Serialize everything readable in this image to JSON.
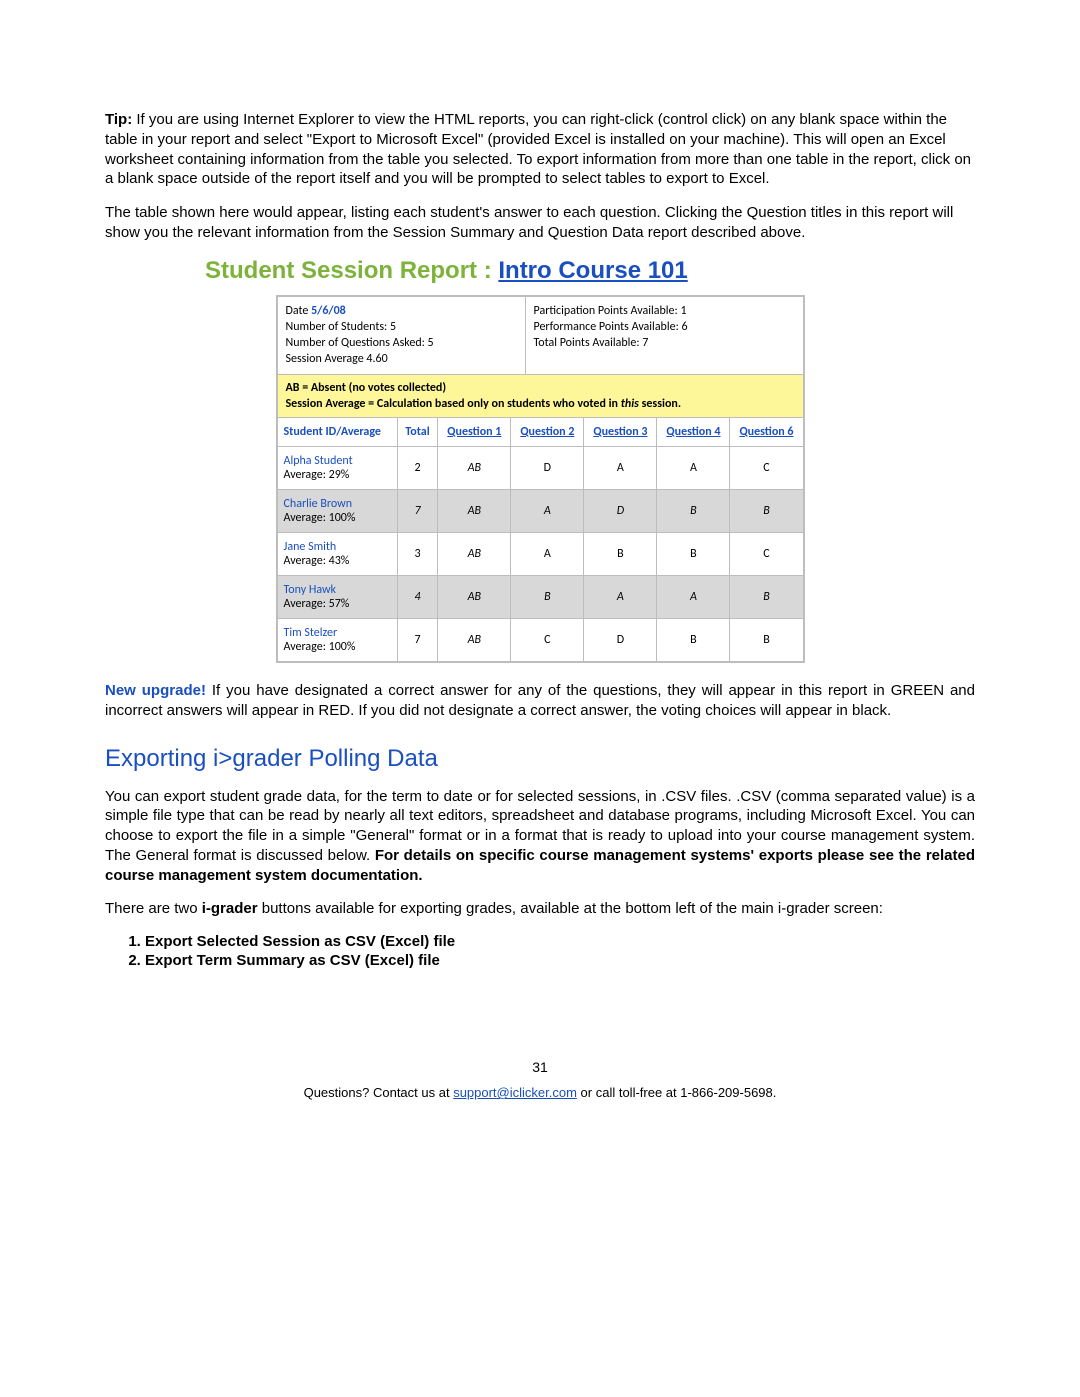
{
  "tip": {
    "label": "Tip:",
    "text": " If you are using Internet Explorer to view the HTML reports, you can right-click (control click) on any blank space within the table in your report and select \"Export to Microsoft Excel\" (provided Excel is installed on your machine). This will open an Excel worksheet containing information from the table you selected. To export information from more than one table in the report, click on a blank space outside of the report itself and you will be prompted to select tables to export to Excel."
  },
  "table_intro": "The table shown here would appear, listing each student's answer to each question.  Clicking the Question titles in this report will show you the relevant information from the Session Summary and Question Data report described above.",
  "report": {
    "title_prefix": "Student Session Report : ",
    "course_link": "Intro Course 101",
    "meta_left": {
      "date_label": "Date ",
      "date_value": "5/6/08",
      "students": "Number of Students: 5",
      "questions": "Number of Questions Asked: 5",
      "avg": "Session Average 4.60"
    },
    "meta_right": {
      "participation": "Participation Points Available: 1",
      "performance": "Performance Points Available: 6",
      "total": "Total Points Available: 7"
    },
    "legend": {
      "ab": "AB = Absent (no votes collected)",
      "calc_prefix": "Session Average = Calculation based only on students who voted in ",
      "calc_em": "this",
      "calc_suffix": " session."
    },
    "columns": {
      "student": "Student ID/Average",
      "total": "Total",
      "q1": "Question 1",
      "q2": "Question 2",
      "q3": "Question 3",
      "q4": "Question 4",
      "q6": "Question 6"
    },
    "rows": [
      {
        "name": "Alpha Student",
        "avg": "Average: 29%",
        "total": "2",
        "q1": "AB",
        "q2": "D",
        "q3": "A",
        "q4": "A",
        "q6": "C",
        "shade": false
      },
      {
        "name": "Charlie Brown",
        "avg": "Average: 100%",
        "total": "7",
        "q1": "AB",
        "q2": "A",
        "q3": "D",
        "q4": "B",
        "q6": "B",
        "shade": true
      },
      {
        "name": "Jane Smith",
        "avg": "Average: 43%",
        "total": "3",
        "q1": "AB",
        "q2": "A",
        "q3": "B",
        "q4": "B",
        "q6": "C",
        "shade": false
      },
      {
        "name": "Tony Hawk",
        "avg": "Average: 57%",
        "total": "4",
        "q1": "AB",
        "q2": "B",
        "q3": "A",
        "q4": "A",
        "q6": "B",
        "shade": true
      },
      {
        "name": "Tim Stelzer",
        "avg": "Average: 100%",
        "total": "7",
        "q1": "AB",
        "q2": "C",
        "q3": "D",
        "q4": "B",
        "q6": "B",
        "shade": false
      }
    ]
  },
  "upgrade": {
    "label": "New upgrade!",
    "text": " If you have designated a correct answer for any of the questions, they will appear in this report in GREEN and incorrect answers will appear in RED. If you did not designate a correct answer, the voting choices will appear in black."
  },
  "export_heading": "Exporting i>grader Polling Data",
  "export_p1_prefix": "You can export student grade data, for the term to date or for selected sessions, in .CSV files. .CSV (comma separated value) is a simple file type that can be read by nearly all text editors, spreadsheet and database programs, including Microsoft Excel.  You can choose to export the file in a simple \"General\" format or in a format that is ready to upload into your course management system. The General format is discussed below. ",
  "export_p1_bold": "For details on specific course management systems' exports please see the related course management system documentation.",
  "export_p2_a": "There are two ",
  "export_p2_b": "i-grader",
  "export_p2_c": " buttons available for exporting grades, available at the bottom left of the main i-grader screen:",
  "export_list": {
    "item1": "Export Selected Session as CSV (Excel) file",
    "item2": "Export Term Summary as CSV (Excel) file"
  },
  "page_number": "31",
  "footer": {
    "prefix": "Questions? Contact us at ",
    "email": "support@iclicker.com",
    "suffix": " or call toll-free at 1-866-209-5698."
  }
}
